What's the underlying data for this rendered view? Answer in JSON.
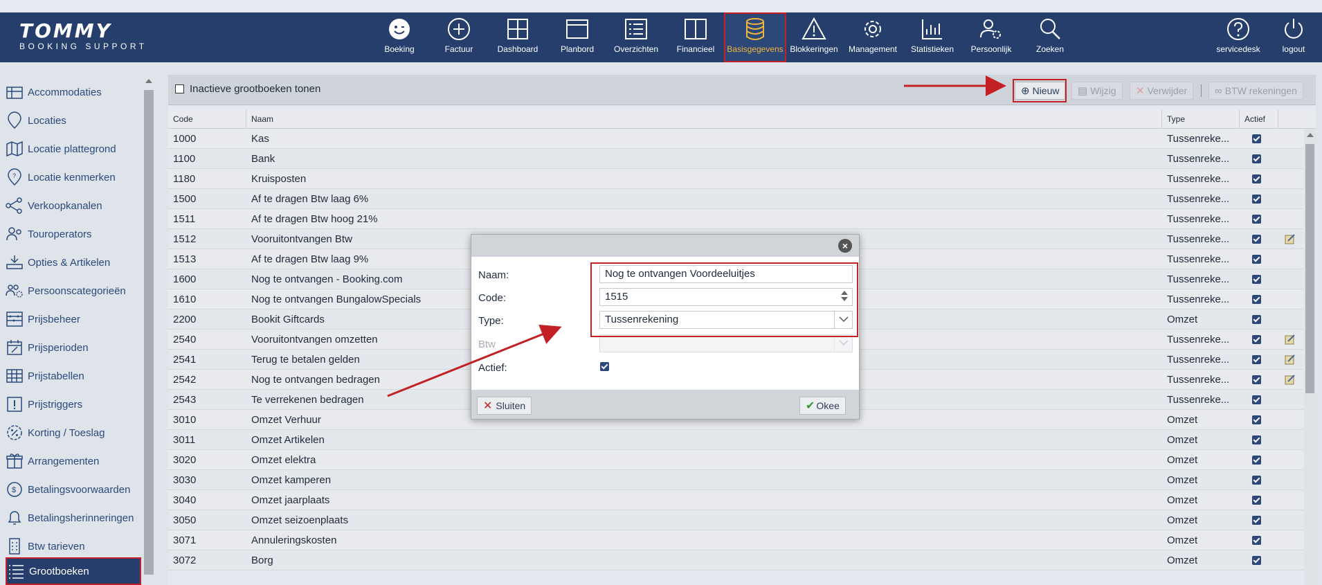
{
  "logo": {
    "main": "TOMMY",
    "sub": "BOOKING SUPPORT"
  },
  "nav": {
    "items": [
      {
        "id": "boeking",
        "label": "Boeking",
        "icon": "smiley-icon"
      },
      {
        "id": "factuur",
        "label": "Factuur",
        "icon": "plus-circle-icon"
      },
      {
        "id": "dashboard",
        "label": "Dashboard",
        "icon": "grid-icon"
      },
      {
        "id": "planbord",
        "label": "Planbord",
        "icon": "window-icon"
      },
      {
        "id": "overzichten",
        "label": "Overzichten",
        "icon": "list-icon"
      },
      {
        "id": "financieel",
        "label": "Financieel",
        "icon": "book-icon"
      },
      {
        "id": "basisgegevens",
        "label": "Basisgegevens",
        "icon": "database-icon",
        "active": true
      },
      {
        "id": "blokkeringen",
        "label": "Blokkeringen",
        "icon": "warning-icon"
      },
      {
        "id": "management",
        "label": "Management",
        "icon": "gear-icon"
      },
      {
        "id": "statistieken",
        "label": "Statistieken",
        "icon": "bar-chart-icon"
      },
      {
        "id": "persoonlijk",
        "label": "Persoonlijk",
        "icon": "user-gear-icon"
      },
      {
        "id": "zoeken",
        "label": "Zoeken",
        "icon": "search-icon"
      }
    ],
    "servicedesk": "servicedesk",
    "logout": "logout"
  },
  "sidebar": {
    "items": [
      {
        "label": "Accommodaties",
        "icon": "building-icon"
      },
      {
        "label": "Locaties",
        "icon": "map-pin-icon"
      },
      {
        "label": "Locatie plattegrond",
        "icon": "map-icon"
      },
      {
        "label": "Locatie kenmerken",
        "icon": "pin-question-icon"
      },
      {
        "label": "Verkoopkanalen",
        "icon": "network-icon"
      },
      {
        "label": "Touroperators",
        "icon": "people-icon"
      },
      {
        "label": "Opties & Artikelen",
        "icon": "tray-icon"
      },
      {
        "label": "Persoonscategorieën",
        "icon": "persons-gear-icon"
      },
      {
        "label": "Prijsbeheer",
        "icon": "abacus-icon"
      },
      {
        "label": "Prijsperioden",
        "icon": "calendar-edit-icon"
      },
      {
        "label": "Prijstabellen",
        "icon": "table-icon"
      },
      {
        "label": "Prijstriggers",
        "icon": "exclamation-box-icon"
      },
      {
        "label": "Korting / Toeslag",
        "icon": "percent-badge-icon"
      },
      {
        "label": "Arrangementen",
        "icon": "gift-icon"
      },
      {
        "label": "Betalingsvoorwaarden",
        "icon": "coin-icon"
      },
      {
        "label": "Betalingsherinneringen",
        "icon": "bell-icon"
      },
      {
        "label": "Btw tarieven",
        "icon": "phone-grid-icon"
      },
      {
        "label": "Grootboeken",
        "icon": "ledger-list-icon",
        "active": true
      }
    ]
  },
  "toolbar": {
    "show_inactive_label": "Inactieve grootboeken tonen",
    "new_label": "Nieuw",
    "edit_label": "Wijzig",
    "delete_label": "Verwijder",
    "vat_accounts_label": "BTW rekeningen"
  },
  "table": {
    "headers": {
      "code": "Code",
      "naam": "Naam",
      "type": "Type",
      "actief": "Actief"
    },
    "rows": [
      {
        "code": "1000",
        "naam": "Kas",
        "type": "Tussenreke...",
        "actief": true,
        "edit": false
      },
      {
        "code": "1100",
        "naam": "Bank",
        "type": "Tussenreke...",
        "actief": true,
        "edit": false
      },
      {
        "code": "1180",
        "naam": "Kruisposten",
        "type": "Tussenreke...",
        "actief": true,
        "edit": false
      },
      {
        "code": "1500",
        "naam": "Af te dragen Btw laag 6%",
        "type": "Tussenreke...",
        "actief": true,
        "edit": false
      },
      {
        "code": "1511",
        "naam": "Af te dragen Btw hoog 21%",
        "type": "Tussenreke...",
        "actief": true,
        "edit": false
      },
      {
        "code": "1512",
        "naam": "Vooruitontvangen Btw",
        "type": "Tussenreke...",
        "actief": true,
        "edit": true
      },
      {
        "code": "1513",
        "naam": "Af te dragen Btw laag 9%",
        "type": "Tussenreke...",
        "actief": true,
        "edit": false
      },
      {
        "code": "1600",
        "naam": "Nog te ontvangen - Booking.com",
        "type": "Tussenreke...",
        "actief": true,
        "edit": false
      },
      {
        "code": "1610",
        "naam": "Nog te ontvangen BungalowSpecials",
        "type": "Tussenreke...",
        "actief": true,
        "edit": false
      },
      {
        "code": "2200",
        "naam": "Bookit Giftcards",
        "type": "Omzet",
        "actief": true,
        "edit": false
      },
      {
        "code": "2540",
        "naam": "Vooruitontvangen omzetten",
        "type": "Tussenreke...",
        "actief": true,
        "edit": true
      },
      {
        "code": "2541",
        "naam": "Terug te betalen gelden",
        "type": "Tussenreke...",
        "actief": true,
        "edit": true
      },
      {
        "code": "2542",
        "naam": "Nog te ontvangen bedragen",
        "type": "Tussenreke...",
        "actief": true,
        "edit": true
      },
      {
        "code": "2543",
        "naam": "Te verrekenen bedragen",
        "type": "Tussenreke...",
        "actief": true,
        "edit": false
      },
      {
        "code": "3010",
        "naam": "Omzet Verhuur",
        "type": "Omzet",
        "actief": true,
        "edit": false
      },
      {
        "code": "3011",
        "naam": "Omzet Artikelen",
        "type": "Omzet",
        "actief": true,
        "edit": false
      },
      {
        "code": "3020",
        "naam": "Omzet elektra",
        "type": "Omzet",
        "actief": true,
        "edit": false
      },
      {
        "code": "3030",
        "naam": "Omzet kamperen",
        "type": "Omzet",
        "actief": true,
        "edit": false
      },
      {
        "code": "3040",
        "naam": "Omzet jaarplaats",
        "type": "Omzet",
        "actief": true,
        "edit": false
      },
      {
        "code": "3050",
        "naam": "Omzet seizoenplaats",
        "type": "Omzet",
        "actief": true,
        "edit": false
      },
      {
        "code": "3071",
        "naam": "Annuleringskosten",
        "type": "Omzet",
        "actief": true,
        "edit": false
      },
      {
        "code": "3072",
        "naam": "Borg",
        "type": "Omzet",
        "actief": true,
        "edit": false
      }
    ]
  },
  "modal": {
    "naam_label": "Naam:",
    "naam_value": "Nog te ontvangen Voordeeluitjes",
    "code_label": "Code:",
    "code_value": "1515",
    "type_label": "Type:",
    "type_value": "Tussenrekening",
    "btw_label": "Btw",
    "btw_value": "",
    "actief_label": "Actief:",
    "actief_value": true,
    "close_label": "Sluiten",
    "ok_label": "Okee"
  },
  "colors": {
    "header": "#253e6b",
    "accent": "#f0b53a",
    "highlight": "#c42127"
  }
}
